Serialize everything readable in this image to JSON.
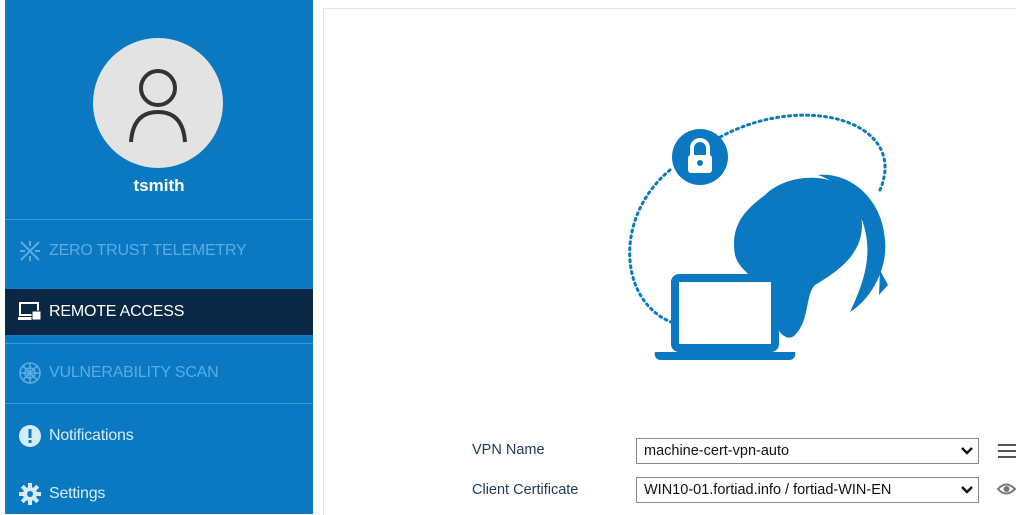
{
  "user": {
    "name": "tsmith"
  },
  "nav": {
    "zero_trust": "ZERO TRUST TELEMETRY",
    "remote_access": "REMOTE ACCESS",
    "vulnerability_scan": "VULNERABILITY SCAN",
    "notifications": "Notifications",
    "settings": "Settings"
  },
  "form": {
    "vpn_name_label": "VPN Name",
    "vpn_name_value": "machine-cert-vpn-auto",
    "client_cert_label": "Client Certificate",
    "client_cert_value": "WIN10-01.fortiad.info / fortiad-WIN-EN"
  },
  "colors": {
    "sidebar": "#0b79c1",
    "active_item": "#0a2843",
    "illustration": "#0b79c1"
  }
}
